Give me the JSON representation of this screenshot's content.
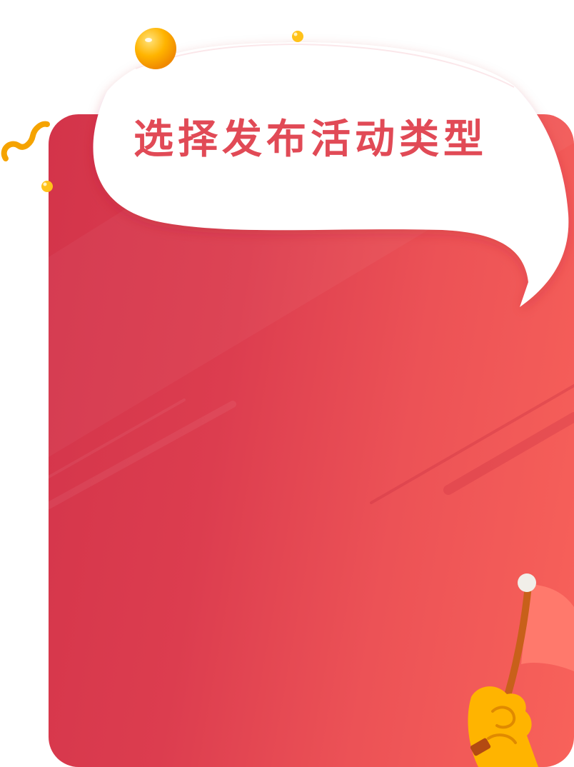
{
  "header": {
    "title": "选择发布活动类型"
  },
  "colors": {
    "card_gradient_start": "#d3344a",
    "card_gradient_end": "#f8625a",
    "title_text": "#e14a56",
    "bubble_fill": "#ffffff",
    "coin": "#ffb400",
    "flag_handle": "#c8601a",
    "hand": "#ffb400"
  },
  "icons": {
    "coin_large": "gold-coin-icon",
    "coin_small": "gold-dot-icon",
    "squiggle": "squiggle-icon",
    "hand_flag": "hand-holding-flag-icon"
  }
}
